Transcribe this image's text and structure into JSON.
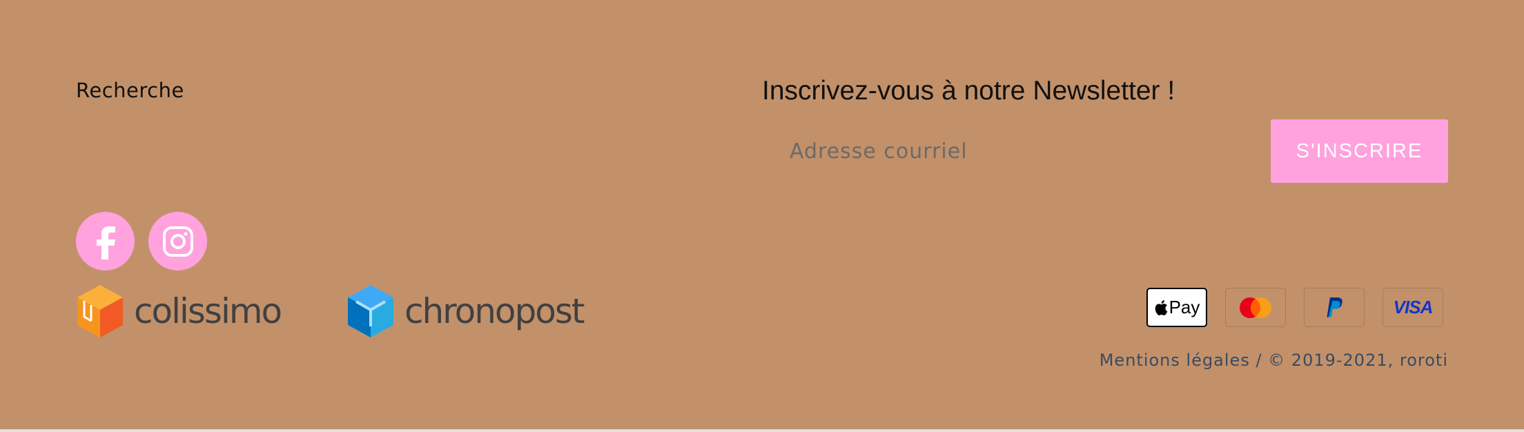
{
  "footer": {
    "search_link": "Recherche",
    "newsletter": {
      "title": "Inscrivez-vous à notre Newsletter !",
      "email_placeholder": "Adresse courriel",
      "subscribe_label": "S'INSCRIRE"
    },
    "social": [
      {
        "name": "facebook",
        "icon": "facebook-icon"
      },
      {
        "name": "instagram",
        "icon": "instagram-icon"
      }
    ],
    "carriers": [
      "colissimo",
      "chronopost"
    ],
    "payments": {
      "apple_pay": "Pay",
      "visa": "VISA"
    },
    "legal": {
      "mentions": "Mentions légales",
      "separator": " / ",
      "copyright": "© 2019-2021, roroti"
    }
  },
  "colors": {
    "background": "#c2916a",
    "accent_pink": "#ffa2de",
    "text_dark": "#111111",
    "copyright_text": "#3a4a5f"
  }
}
